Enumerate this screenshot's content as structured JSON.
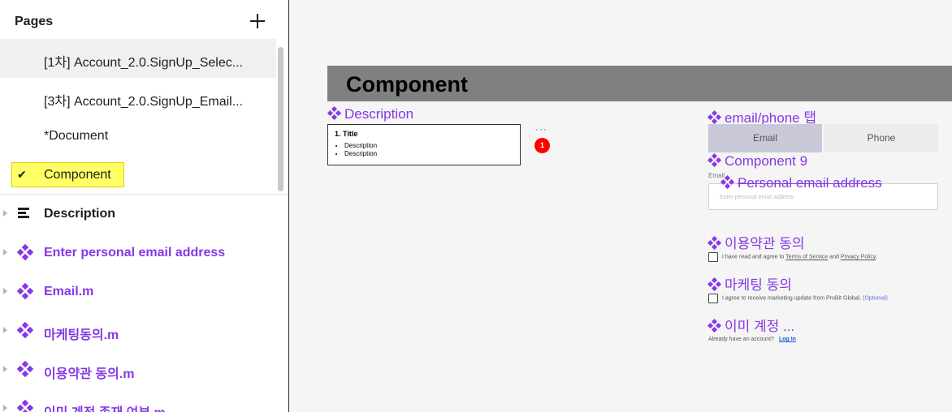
{
  "left_panel": {
    "pages_title": "Pages",
    "pages": [
      {
        "label": "[1차] Account_2.0.SignUp_Selec..."
      },
      {
        "label": "[3차] Account_2.0.SignUp_Email..."
      },
      {
        "label": "*Document"
      },
      {
        "label": "Component"
      }
    ],
    "layers": [
      {
        "label": "Description",
        "icon": "lines-icon",
        "color": "#1e1e1e"
      },
      {
        "label": "Enter personal email address",
        "icon": "component-icon",
        "color": "#8638e5"
      },
      {
        "label": "Email.m",
        "icon": "component-icon",
        "color": "#8638e5"
      },
      {
        "label": "마케팅동의.m",
        "icon": "component-icon",
        "color": "#8638e5"
      },
      {
        "label": "이용약관 동의.m",
        "icon": "component-icon",
        "color": "#8638e5"
      },
      {
        "label": "이미 계정 존재 여부.m",
        "icon": "component-icon",
        "color": "#8638e5"
      }
    ]
  },
  "canvas": {
    "frame_title": "Component",
    "description_label": "Description",
    "description_card": {
      "title": "1. Title",
      "items": [
        "Description",
        "Description"
      ]
    },
    "dots": "···",
    "badge": "1",
    "tab_label": "email/phone 탭",
    "tabs": {
      "email": "Email",
      "phone": "Phone"
    },
    "component9_label": "Component 9",
    "email_small_label": "Email",
    "personal_email_label": "Personal email address",
    "email_placeholder": "Enter personal email address",
    "terms_label": "이용약관 동의",
    "terms_text_1": "I have read and agree to ",
    "terms_link_1": "Terms of Service",
    "terms_text_2": " and ",
    "terms_link_2": "Privacy Policy",
    "terms_text_3": ".",
    "marketing_label": "마케팅 동의",
    "marketing_text": "I agree to receive marketing update from ProBit Global.",
    "marketing_optional": "(Optional)",
    "existing_label": "이미 계정 ...",
    "already_text": "Already have an account?",
    "login_text": "Log In"
  },
  "colors": {
    "accent": "#8638e5",
    "highlight": "#ffff66",
    "badge": "#ff0000",
    "frame_header": "#808080"
  }
}
